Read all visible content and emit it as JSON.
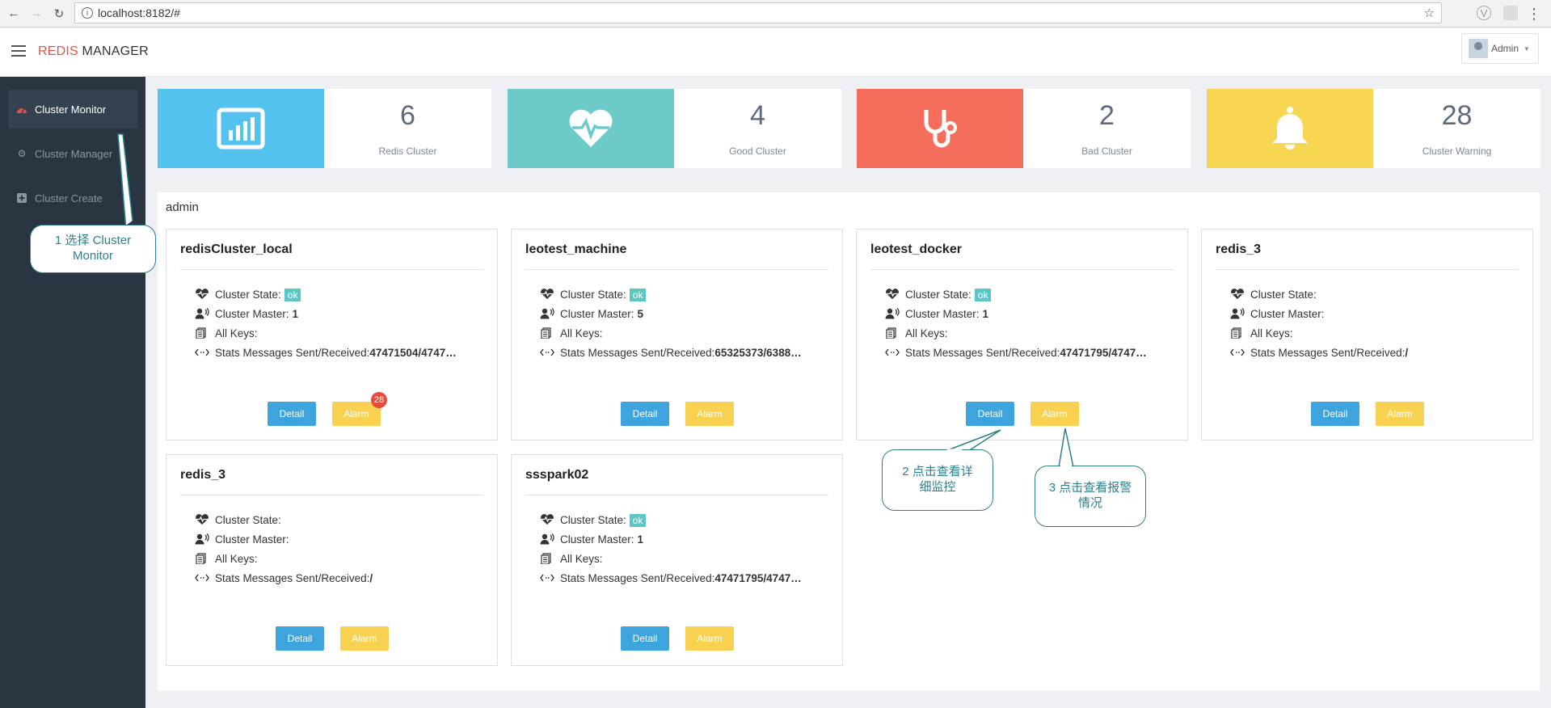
{
  "browser": {
    "url": "localhost:8182/#"
  },
  "header": {
    "brand_accent": "REDIS",
    "brand_rest": " MANAGER",
    "user": "Admin"
  },
  "sidebar": {
    "items": [
      {
        "label": "Cluster Monitor",
        "icon": "dashboard-icon",
        "active": true
      },
      {
        "label": "Cluster Manager",
        "icon": "gear-icon",
        "active": false
      },
      {
        "label": "Cluster Create",
        "icon": "plus-square-icon",
        "active": false
      }
    ]
  },
  "stats": [
    {
      "value": "6",
      "label": "Redis Cluster",
      "color": "#53c2ef",
      "icon": "chart-board-icon"
    },
    {
      "value": "4",
      "label": "Good Cluster",
      "color": "#6ccbc8",
      "icon": "heartbeat-icon"
    },
    {
      "value": "2",
      "label": "Bad Cluster",
      "color": "#f46e5b",
      "icon": "stethoscope-icon"
    },
    {
      "value": "28",
      "label": "Cluster Warning",
      "color": "#f7d652",
      "icon": "bell-icon"
    }
  ],
  "panel": {
    "title": "admin",
    "labels": {
      "state": "Cluster State:",
      "master": "Cluster Master:",
      "keys": "All Keys:",
      "messages": "Stats Messages Sent/Received:",
      "detail": "Detail",
      "alarm": "Alarm"
    },
    "clusters": [
      {
        "name": "redisCluster_local",
        "state": "ok",
        "master": "1",
        "keys": "",
        "messages": "47471504/4747…",
        "alarm_count": "28"
      },
      {
        "name": "leotest_machine",
        "state": "ok",
        "master": "5",
        "keys": "",
        "messages": "65325373/6388…",
        "alarm_count": ""
      },
      {
        "name": "leotest_docker",
        "state": "ok",
        "master": "1",
        "keys": "",
        "messages": "47471795/4747…",
        "alarm_count": ""
      },
      {
        "name": "redis_3",
        "state": "",
        "master": "",
        "keys": "",
        "messages": "/",
        "alarm_count": ""
      },
      {
        "name": "redis_3",
        "state": "",
        "master": "",
        "keys": "",
        "messages": "/",
        "alarm_count": ""
      },
      {
        "name": "ssspark02",
        "state": "ok",
        "master": "1",
        "keys": "",
        "messages": "47471795/4747…",
        "alarm_count": ""
      }
    ]
  },
  "callouts": {
    "c1": "1 选择  Cluster Monitor",
    "c2": "2 点击查看详细监控",
    "c3": "3 点击查看报警情况"
  }
}
